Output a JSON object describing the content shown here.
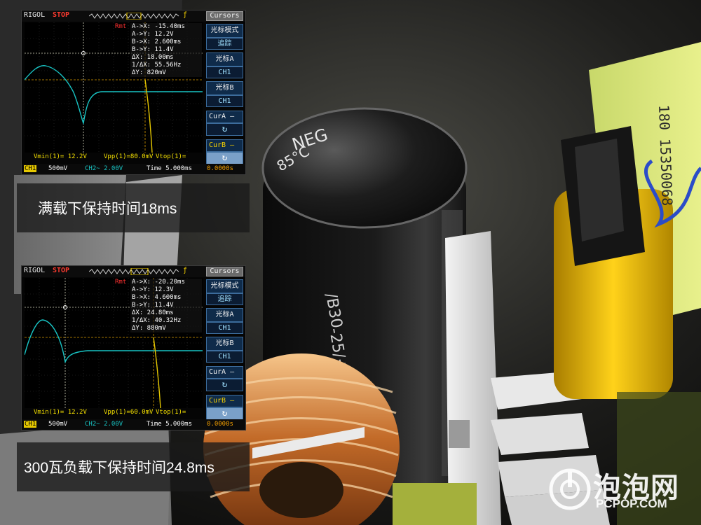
{
  "scope1": {
    "brand": "RIGOL",
    "state": "STOP",
    "trig_marker": "ƒ",
    "rmt": "Rmt",
    "menu_title": "Cursors",
    "menu": [
      {
        "label": "光标模式",
        "value": "追踪"
      },
      {
        "label": "光标A",
        "value": "CH1"
      },
      {
        "label": "光标B",
        "value": "CH1"
      },
      {
        "label": "CurA —",
        "value": "↻"
      },
      {
        "label": "CurB —",
        "value": "↻"
      }
    ],
    "readout": [
      "A->X: -15.40ms",
      "A->Y: 12.2V",
      "B->X: 2.600ms",
      "B->Y: 11.4V",
      "ΔX: 18.00ms",
      "1/ΔX: 55.56Hz",
      "ΔY: 820mV"
    ],
    "vmin": "Vmin(1)= 12.2V",
    "vpp": "Vpp(1)=80.0mV",
    "vtop": "Vtop(1)=",
    "ch1": "CH1",
    "ch1_scale": "500mV",
    "ch2": "CH2~ 2.00V",
    "time": "Time 5.000ms",
    "offset": "0.0000s"
  },
  "scope2": {
    "brand": "RIGOL",
    "state": "STOP",
    "trig_marker": "ƒ",
    "rmt": "Rmt",
    "menu_title": "Cursors",
    "menu": [
      {
        "label": "光标模式",
        "value": "追踪"
      },
      {
        "label": "光标A",
        "value": "CH1"
      },
      {
        "label": "光标B",
        "value": "CH1"
      },
      {
        "label": "CurA —",
        "value": "↻"
      },
      {
        "label": "CurB —",
        "value": "↻"
      }
    ],
    "readout": [
      "A->X: -20.20ms",
      "A->Y: 12.3V",
      "B->X: 4.600ms",
      "B->Y: 11.4V",
      "ΔX: 24.80ms",
      "1/ΔX: 40.32Hz",
      "ΔY: 880mV"
    ],
    "vmin": "Vmin(1)= 12.2V",
    "vpp": "Vpp(1)=60.0mV",
    "vtop": "Vtop(1)=",
    "ch1": "CH1",
    "ch1_scale": "500mV",
    "ch2": "CH2~ 2.00V",
    "time": "Time 5.000ms",
    "offset": "0.0000s"
  },
  "captions": {
    "full_load": "满载下保持时间18ms",
    "load_300w": "300瓦负载下保持时间24.8ms"
  },
  "capacitor_text": [
    "NEG",
    "85°C",
    "/B30",
    "-25/+85°C"
  ],
  "transformer_text": "180 15350068",
  "watermark": {
    "cn": "泡泡网",
    "en": "PCPOP.COM"
  }
}
